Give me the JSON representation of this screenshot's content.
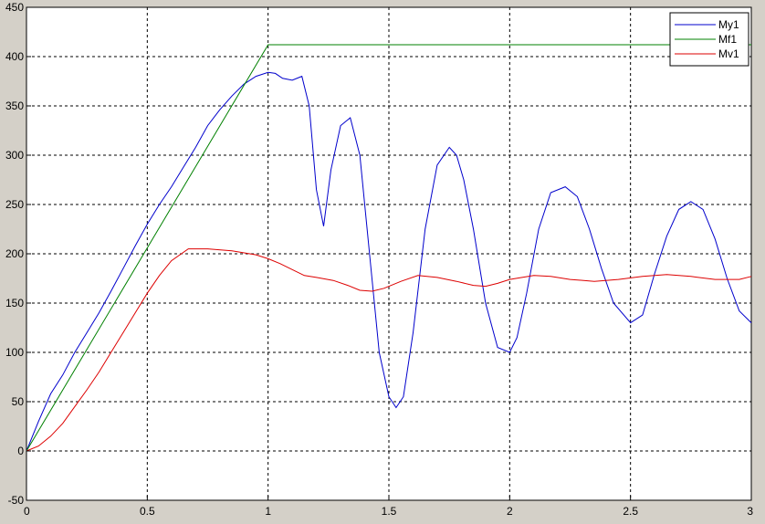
{
  "chart_data": {
    "type": "line",
    "title": "",
    "xlabel": "",
    "ylabel": "",
    "xlim": [
      0,
      3
    ],
    "ylim": [
      -50,
      450
    ],
    "x_ticks": [
      0,
      0.5,
      1,
      1.5,
      2,
      2.5,
      3
    ],
    "x_tick_labels": [
      "0",
      "0.5",
      "1",
      "1.5",
      "2",
      "2.5",
      "3"
    ],
    "y_ticks": [
      -50,
      0,
      50,
      100,
      150,
      200,
      250,
      300,
      350,
      400,
      450
    ],
    "y_tick_labels": [
      "-50",
      "0",
      "50",
      "100",
      "150",
      "200",
      "250",
      "300",
      "350",
      "400",
      "450"
    ],
    "grid": true,
    "grid_style": "dashed",
    "legend_position": "top-right",
    "series": [
      {
        "name": "My1",
        "color": "#0000cc",
        "x": [
          0,
          0.05,
          0.1,
          0.15,
          0.2,
          0.25,
          0.3,
          0.35,
          0.4,
          0.45,
          0.5,
          0.55,
          0.6,
          0.65,
          0.7,
          0.75,
          0.8,
          0.85,
          0.9,
          0.95,
          1.0,
          1.03,
          1.06,
          1.1,
          1.14,
          1.17,
          1.2,
          1.23,
          1.26,
          1.3,
          1.34,
          1.38,
          1.42,
          1.46,
          1.5,
          1.53,
          1.56,
          1.6,
          1.65,
          1.7,
          1.75,
          1.78,
          1.81,
          1.85,
          1.9,
          1.95,
          2.0,
          2.03,
          2.07,
          2.12,
          2.17,
          2.23,
          2.28,
          2.33,
          2.38,
          2.43,
          2.5,
          2.55,
          2.6,
          2.65,
          2.7,
          2.75,
          2.8,
          2.85,
          2.9,
          2.95,
          3.0
        ],
        "y": [
          0,
          30,
          58,
          77,
          100,
          120,
          140,
          162,
          185,
          208,
          230,
          250,
          268,
          288,
          308,
          330,
          346,
          360,
          372,
          380,
          384,
          383,
          378,
          376,
          380,
          350,
          265,
          228,
          285,
          330,
          338,
          300,
          200,
          100,
          55,
          44,
          55,
          120,
          225,
          290,
          308,
          300,
          275,
          225,
          150,
          105,
          100,
          115,
          160,
          225,
          262,
          268,
          258,
          225,
          185,
          150,
          130,
          138,
          180,
          218,
          245,
          253,
          245,
          215,
          175,
          142,
          130
        ]
      },
      {
        "name": "Mf1",
        "color": "#008000",
        "x": [
          0,
          1.0,
          3.0
        ],
        "y": [
          0,
          412,
          412
        ]
      },
      {
        "name": "Mv1",
        "color": "#dd0000",
        "x": [
          0,
          0.05,
          0.1,
          0.15,
          0.2,
          0.25,
          0.3,
          0.35,
          0.4,
          0.45,
          0.5,
          0.55,
          0.6,
          0.67,
          0.75,
          0.85,
          0.95,
          1.0,
          1.05,
          1.1,
          1.15,
          1.2,
          1.27,
          1.33,
          1.38,
          1.43,
          1.48,
          1.55,
          1.62,
          1.7,
          1.78,
          1.85,
          1.9,
          1.95,
          2.0,
          2.1,
          2.17,
          2.25,
          2.35,
          2.45,
          2.55,
          2.65,
          2.75,
          2.85,
          2.95,
          3.0
        ],
        "y": [
          0,
          5,
          15,
          28,
          45,
          62,
          80,
          100,
          120,
          140,
          160,
          178,
          193,
          205,
          205,
          203,
          199,
          195,
          190,
          184,
          178,
          176,
          173,
          168,
          163,
          162,
          165,
          172,
          178,
          176,
          172,
          168,
          167,
          170,
          174,
          178,
          177,
          174,
          172,
          174,
          177,
          179,
          177,
          174,
          174,
          177
        ]
      }
    ]
  }
}
